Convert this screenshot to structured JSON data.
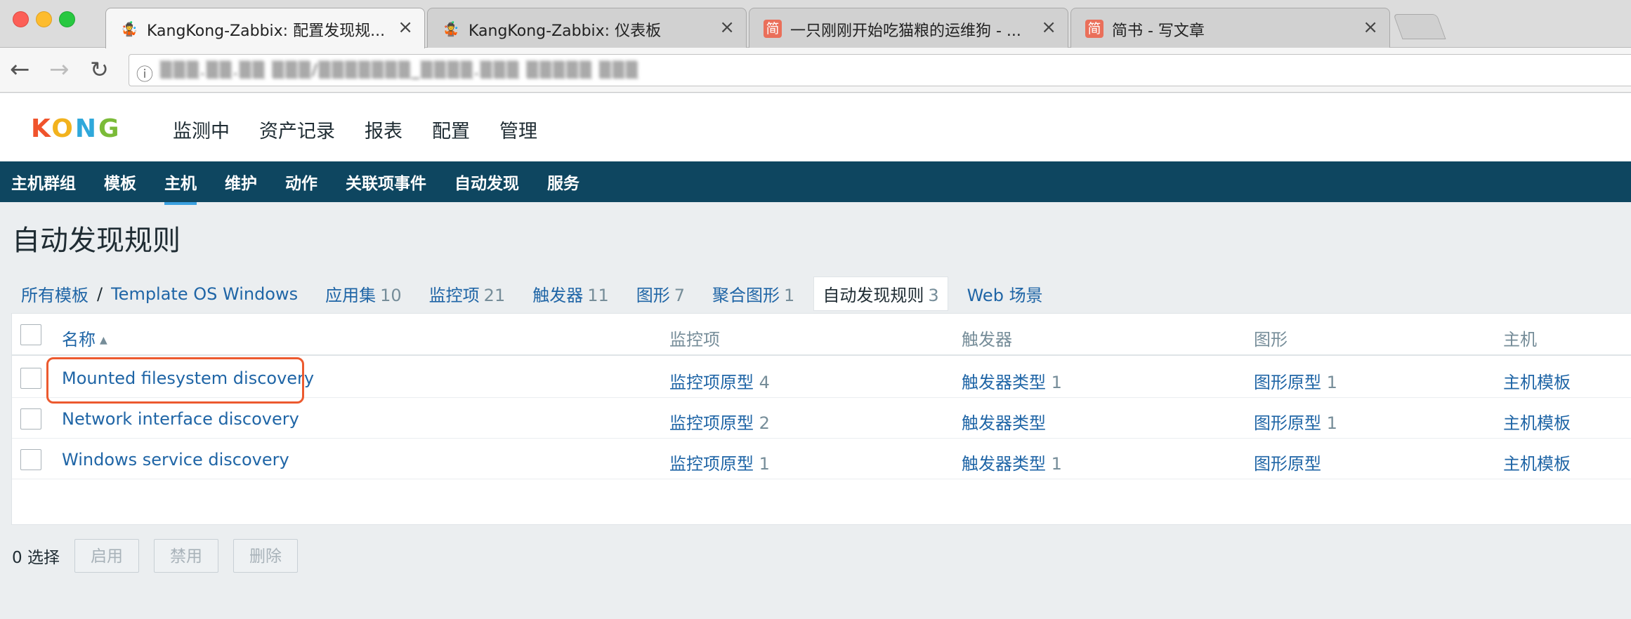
{
  "browser": {
    "tabs": [
      {
        "title": "KangKong-Zabbix: 配置发现规...",
        "icon": "zabbix-favicon",
        "active": true
      },
      {
        "title": "KangKong-Zabbix: 仪表板",
        "icon": "zabbix-favicon",
        "active": false
      },
      {
        "title": "一只刚刚开始吃猫粮的运维狗 - ...",
        "icon": "jianshu-favicon",
        "active": false
      },
      {
        "title": "简书 - 写文章",
        "icon": "jianshu-favicon",
        "active": false
      }
    ],
    "close_glyph": "×",
    "favicon_zabbix": "🤹",
    "favicon_jianshu": "简",
    "url": "▒▒▒.▒▒.▒▒ ▒▒▒/▒▒▒▒▒▒▒_▒▒▒▒.▒▒▒ ▒▒▒▒▒ ▒▒▒"
  },
  "header": {
    "logo": {
      "k": "K",
      "o": "O",
      "n": "N",
      "g": "G"
    },
    "menu": [
      "监测中",
      "资产记录",
      "报表",
      "配置",
      "管理"
    ],
    "selected_menu": "配置"
  },
  "submenu": {
    "items": [
      "主机群组",
      "模板",
      "主机",
      "维护",
      "动作",
      "关联项事件",
      "自动发现",
      "服务"
    ],
    "selected": "主机"
  },
  "page": {
    "title": "自动发现规则"
  },
  "breadcrumb": {
    "all_templates": "所有模板",
    "separator": "/",
    "template": "Template OS Windows",
    "nav": [
      {
        "label": "应用集",
        "count": "10"
      },
      {
        "label": "监控项",
        "count": "21"
      },
      {
        "label": "触发器",
        "count": "11"
      },
      {
        "label": "图形",
        "count": "7"
      },
      {
        "label": "聚合图形",
        "count": "1"
      },
      {
        "label": "自动发现规则",
        "count": "3"
      },
      {
        "label": "Web 场景",
        "count": ""
      }
    ]
  },
  "table": {
    "headers": {
      "name": "名称",
      "sort_indicator": "▲",
      "items": "监控项",
      "triggers": "触发器",
      "graphs": "图形",
      "hosts": "主机"
    },
    "rows": [
      {
        "name": "Mounted filesystem discovery",
        "items": "监控项原型",
        "items_count": "4",
        "triggers": "触发器类型",
        "triggers_count": "1",
        "graphs": "图形原型",
        "graphs_count": "1",
        "hosts": "主机模板"
      },
      {
        "name": "Network interface discovery",
        "items": "监控项原型",
        "items_count": "2",
        "triggers": "触发器类型",
        "triggers_count": "",
        "graphs": "图形原型",
        "graphs_count": "1",
        "hosts": "主机模板"
      },
      {
        "name": "Windows service discovery",
        "items": "监控项原型",
        "items_count": "1",
        "triggers": "触发器类型",
        "triggers_count": "1",
        "graphs": "图形原型",
        "graphs_count": "",
        "hosts": "主机模板"
      }
    ],
    "highlight_color": "#ec5a2f"
  },
  "footer": {
    "selected_count": "0 选择",
    "buttons": [
      "启用",
      "禁用",
      "删除"
    ]
  },
  "colors": {
    "nav_bar": "#0e4660",
    "link": "#1f65a6",
    "muted": "#768d99",
    "background": "#ebeef0"
  }
}
